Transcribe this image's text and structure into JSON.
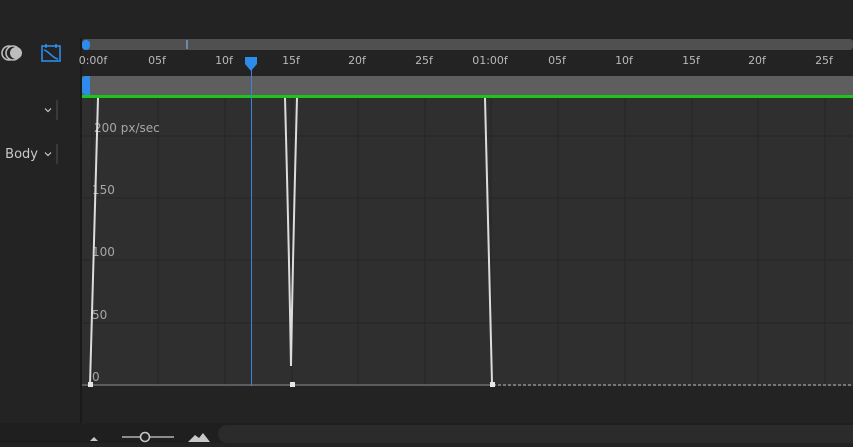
{
  "left_panel": {
    "dropdown_1": {
      "value": ""
    },
    "dropdown_2": {
      "value": "Body"
    }
  },
  "ruler": {
    "ticks": [
      "0:00f",
      "05f",
      "10f",
      "15f",
      "20f",
      "25f",
      "01:00f",
      "05f",
      "10f",
      "15f",
      "20f",
      "25f"
    ]
  },
  "graph": {
    "y_unit_label": "200 px/sec",
    "y_labels": [
      "150",
      "100",
      "50",
      "0"
    ]
  },
  "colors": {
    "playhead": "#3a86d6",
    "green_bar": "#1bc51b",
    "accent_blue": "#2d8ceb"
  }
}
